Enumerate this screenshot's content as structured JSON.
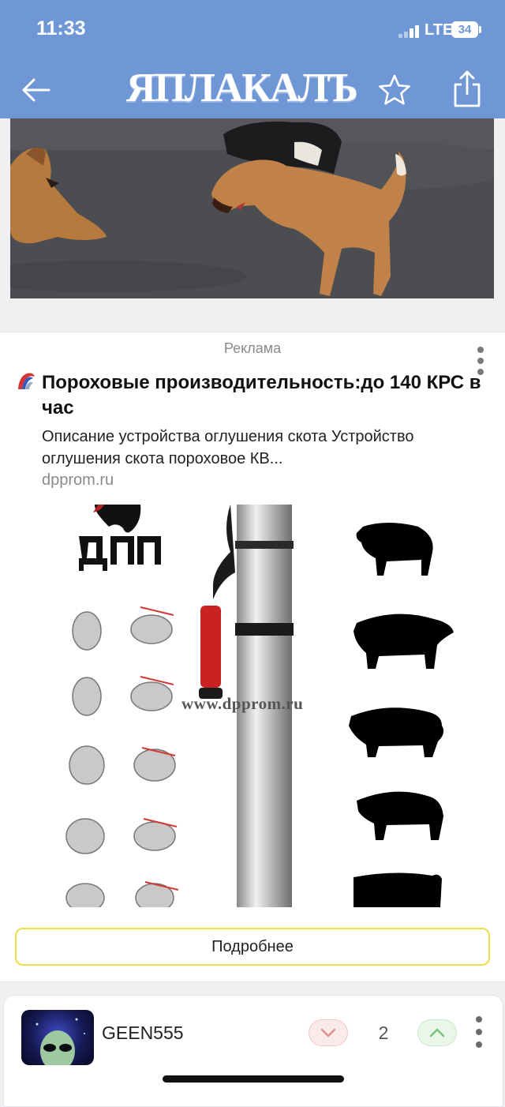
{
  "status": {
    "time": "11:33",
    "network": "LTE",
    "battery": "34"
  },
  "header": {
    "logo_text": "ЯПЛАКАЛЪ",
    "back_icon": "arrow-left-icon",
    "favorite_icon": "star-icon",
    "share_icon": "share-icon",
    "background": "#6f97d6"
  },
  "ad": {
    "label": "Реклама",
    "title": "Пороховые производительность:до 140 КРС в час",
    "description": "Описание устройства оглушения скота Устройство оглушения скота пороховое КВ...",
    "domain": "dpprom.ru",
    "image_watermark": "www.dpprom.ru",
    "image_logo": "ДПП",
    "more_button": "Подробнее",
    "button_border": "#f2dc4a"
  },
  "comment": {
    "username": "GEEN555",
    "score": "2",
    "downvote_color": "#e08c8c",
    "upvote_color": "#7cc67c"
  }
}
